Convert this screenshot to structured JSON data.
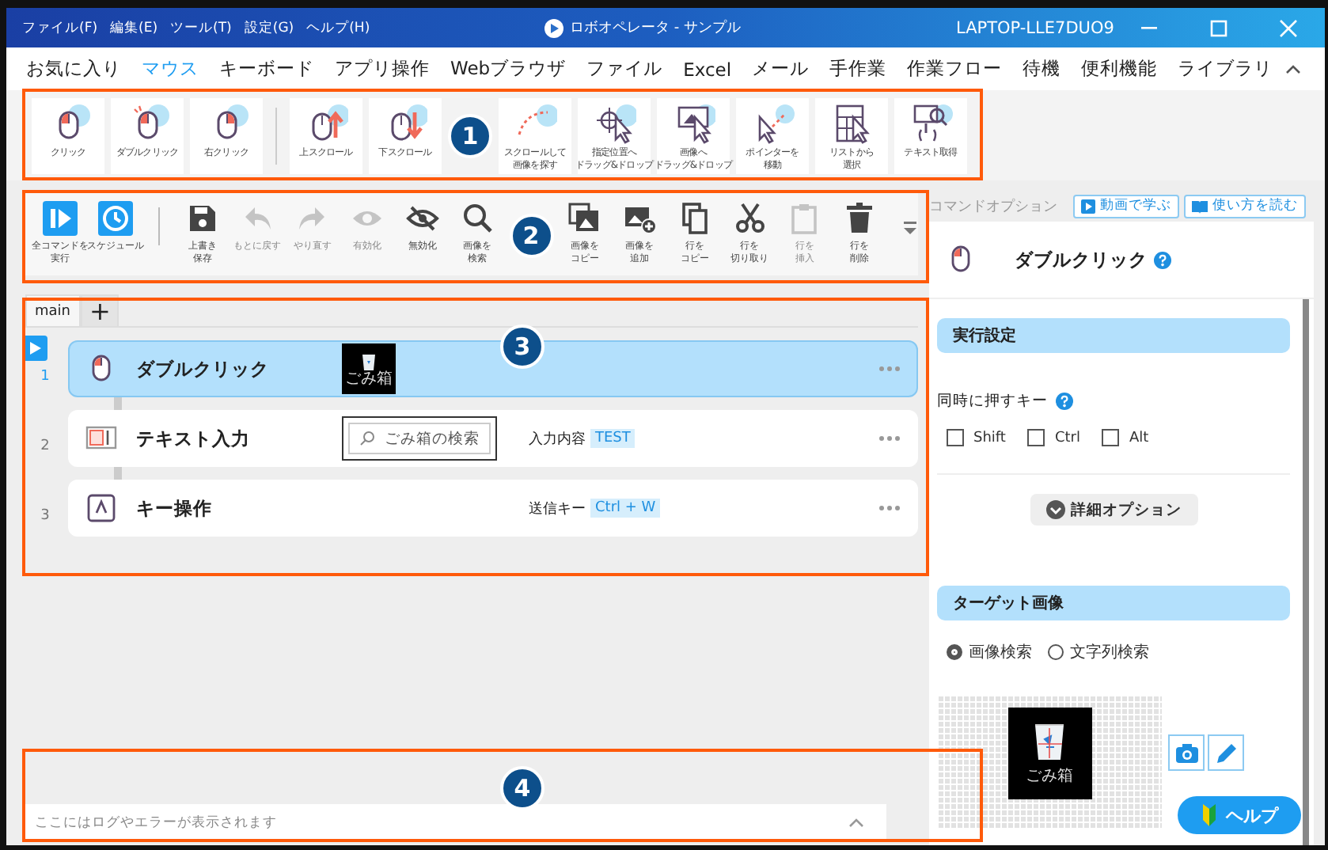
{
  "window": {
    "menu": [
      "ファイル(F)",
      "編集(E)",
      "ツール(T)",
      "設定(G)",
      "ヘルプ(H)"
    ],
    "title": "ロボオペレータ - サンプル",
    "machine": "LAPTOP-LLE7DUO9"
  },
  "ribbon": {
    "tabs": [
      {
        "label": "お気に入り",
        "selected": false
      },
      {
        "label": "マウス",
        "selected": true
      },
      {
        "label": "キーボード",
        "selected": false
      },
      {
        "label": "アプリ操作",
        "selected": false
      },
      {
        "label": "Webブラウザ",
        "selected": false
      },
      {
        "label": "ファイル",
        "selected": false
      },
      {
        "label": "Excel",
        "selected": false
      },
      {
        "label": "メール",
        "selected": false
      },
      {
        "label": "手作業",
        "selected": false
      },
      {
        "label": "作業フロー",
        "selected": false
      },
      {
        "label": "待機",
        "selected": false
      },
      {
        "label": "便利機能",
        "selected": false
      },
      {
        "label": "ライブラリ",
        "selected": false
      }
    ],
    "tool_groups": [
      [
        {
          "kind": "click",
          "lines": [
            "クリック"
          ]
        },
        {
          "kind": "double",
          "lines": [
            "ダブルクリック"
          ]
        },
        {
          "kind": "right",
          "lines": [
            "右クリック"
          ]
        }
      ],
      [
        {
          "kind": "scroll_up",
          "lines": [
            "上スクロール"
          ]
        },
        {
          "kind": "scroll_down",
          "lines": [
            "下スクロール"
          ]
        },
        {
          "kind": "scroll_find",
          "lines": [
            "スクロールして",
            "画像を探す"
          ]
        },
        {
          "kind": "drag_pos",
          "lines": [
            "指定位置へ",
            "ドラッグ&ドロップ"
          ]
        },
        {
          "kind": "drag_img",
          "lines": [
            "画像へ",
            "ドラッグ&ドロップ"
          ]
        },
        {
          "kind": "pointer",
          "lines": [
            "ポインターを",
            "移動"
          ]
        },
        {
          "kind": "list",
          "lines": [
            "リストから",
            "選択"
          ]
        },
        {
          "kind": "text_get",
          "lines": [
            "テキスト取得"
          ]
        }
      ]
    ]
  },
  "toolbar": {
    "groups": [
      [
        {
          "kind": "run",
          "lines": [
            "全コマンドを",
            "実行"
          ],
          "disabled": false
        },
        {
          "kind": "schedule",
          "lines": [
            "スケジュール"
          ],
          "disabled": false
        }
      ],
      [
        {
          "kind": "save",
          "lines": [
            "上書き",
            "保存"
          ],
          "disabled": false
        },
        {
          "kind": "undo",
          "lines": [
            "もとに戻す"
          ],
          "disabled": true
        },
        {
          "kind": "redo",
          "lines": [
            "やり直す"
          ],
          "disabled": true
        },
        {
          "kind": "enable",
          "lines": [
            "有効化"
          ],
          "disabled": true
        },
        {
          "kind": "disable",
          "lines": [
            "無効化"
          ],
          "disabled": false
        },
        {
          "kind": "search",
          "lines": [
            "画像を",
            "検索"
          ],
          "disabled": false
        },
        {
          "kind": "image_copy",
          "lines": [
            "画像を",
            "コピー"
          ],
          "disabled": false
        },
        {
          "kind": "image_add",
          "lines": [
            "画像を",
            "追加"
          ],
          "disabled": false
        },
        {
          "kind": "copy",
          "lines": [
            "行を",
            "コピー"
          ],
          "disabled": false
        },
        {
          "kind": "cut",
          "lines": [
            "行を",
            "切り取り"
          ],
          "disabled": false
        },
        {
          "kind": "paste",
          "lines": [
            "行を",
            "挿入"
          ],
          "disabled": true
        },
        {
          "kind": "delete",
          "lines": [
            "行を",
            "削除"
          ],
          "disabled": false
        }
      ]
    ]
  },
  "flow": {
    "tabs": [
      {
        "label": "main",
        "selected": true
      },
      {
        "label": "+",
        "selected": false
      }
    ],
    "rows": [
      {
        "number": "1",
        "kind": "mouse",
        "title": "ダブルクリック",
        "selected": true,
        "current": true,
        "preview": {
          "kind": "image",
          "caption": "ごみ箱"
        }
      },
      {
        "number": "2",
        "kind": "text",
        "title": "テキスト入力",
        "selected": false,
        "current": false,
        "preview": {
          "kind": "search",
          "text": "ごみ箱の検索"
        },
        "param_label": "入力内容",
        "param_value": "TEST"
      },
      {
        "number": "3",
        "kind": "key",
        "title": "キー操作",
        "selected": false,
        "current": false,
        "param_label": "送信キー",
        "param_value": "Ctrl + W"
      }
    ]
  },
  "log": {
    "message": "ここにはログやエラーが表示されます"
  },
  "options": {
    "header": "コマンドオプション",
    "links": [
      "動画で学ぶ",
      "使い方を読む"
    ],
    "command": {
      "kind": "mouse",
      "title": "ダブルクリック"
    },
    "execution": {
      "title": "実行設定",
      "keys_label": "同時に押すキー",
      "keys": [
        {
          "label": "Shift",
          "checked": false
        },
        {
          "label": "Ctrl",
          "checked": false
        },
        {
          "label": "Alt",
          "checked": false
        }
      ],
      "advanced": "詳細オプション"
    },
    "target": {
      "title": "ターゲット画像",
      "modes": [
        {
          "label": "画像検索",
          "selected": true
        },
        {
          "label": "文字列検索",
          "selected": false
        }
      ],
      "image_caption": "ごみ箱"
    },
    "help": "ヘルプ"
  },
  "annotations": [
    {
      "number": "1"
    },
    {
      "number": "2"
    },
    {
      "number": "3"
    },
    {
      "number": "4"
    }
  ]
}
